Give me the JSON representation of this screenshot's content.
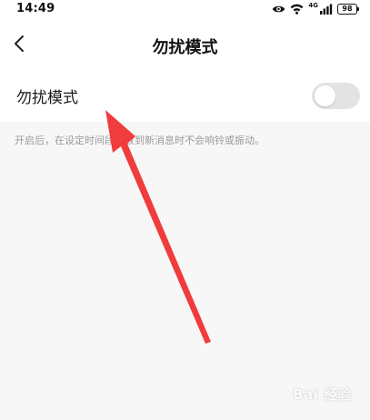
{
  "status_bar": {
    "time": "14:49",
    "network": "4G",
    "battery": "98"
  },
  "header": {
    "title": "勿扰模式",
    "back_icon": "chevron-left-icon"
  },
  "setting": {
    "label": "勿扰模式",
    "enabled": false,
    "description": "开启后，在设定时间段内收到新消息时不会响铃或振动。"
  },
  "annotation": {
    "color": "#f03c3c"
  },
  "colors": {
    "background": "#f7f7f7",
    "surface": "#ffffff",
    "toggle_off": "#e3e3e3",
    "description_text": "#9a9a9a"
  },
  "watermark": "Bai 经验"
}
